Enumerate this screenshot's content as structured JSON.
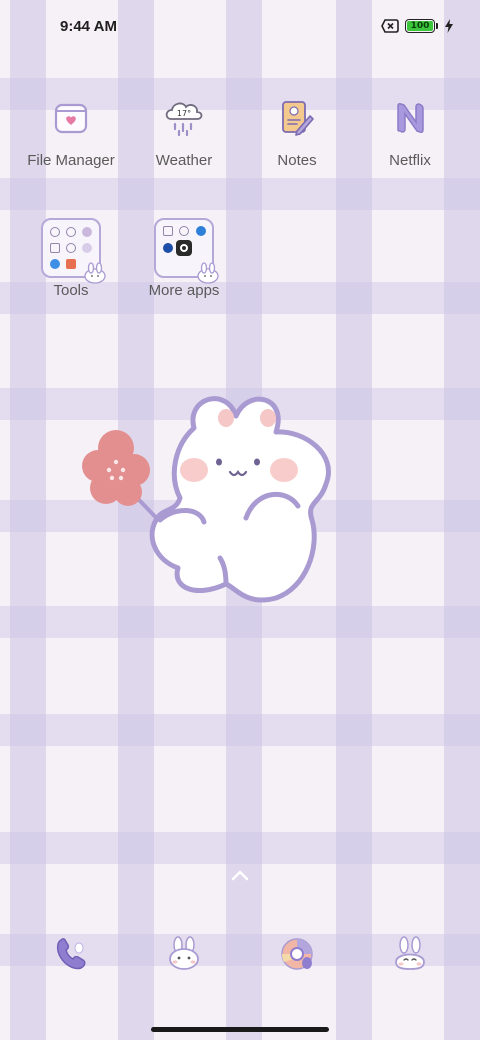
{
  "status_bar": {
    "time": "9:44 AM",
    "battery_level": "100",
    "battery_percent": 100,
    "battery_color": "#3cc63c",
    "icons": [
      "no-sim-icon",
      "battery-icon",
      "charging-bolt-icon"
    ]
  },
  "apps": [
    {
      "label": "File Manager",
      "icon": "folder-heart-icon"
    },
    {
      "label": "Weather",
      "icon": "rain-cloud-icon",
      "badge": "17°"
    },
    {
      "label": "Notes",
      "icon": "notepad-pencil-icon"
    },
    {
      "label": "Netflix",
      "icon": "netflix-n-icon"
    }
  ],
  "folders": [
    {
      "label": "Tools",
      "icon": "tools-folder-icon"
    },
    {
      "label": "More apps",
      "icon": "more-apps-folder-icon"
    }
  ],
  "dock": [
    {
      "icon": "phone-icon"
    },
    {
      "icon": "bunny-messages-icon"
    },
    {
      "icon": "browser-icon"
    },
    {
      "icon": "bunny-camera-icon"
    }
  ],
  "theme": {
    "accent": "#b5a8d8",
    "background": "#f6f1f6",
    "flower": "#e48f8f"
  }
}
